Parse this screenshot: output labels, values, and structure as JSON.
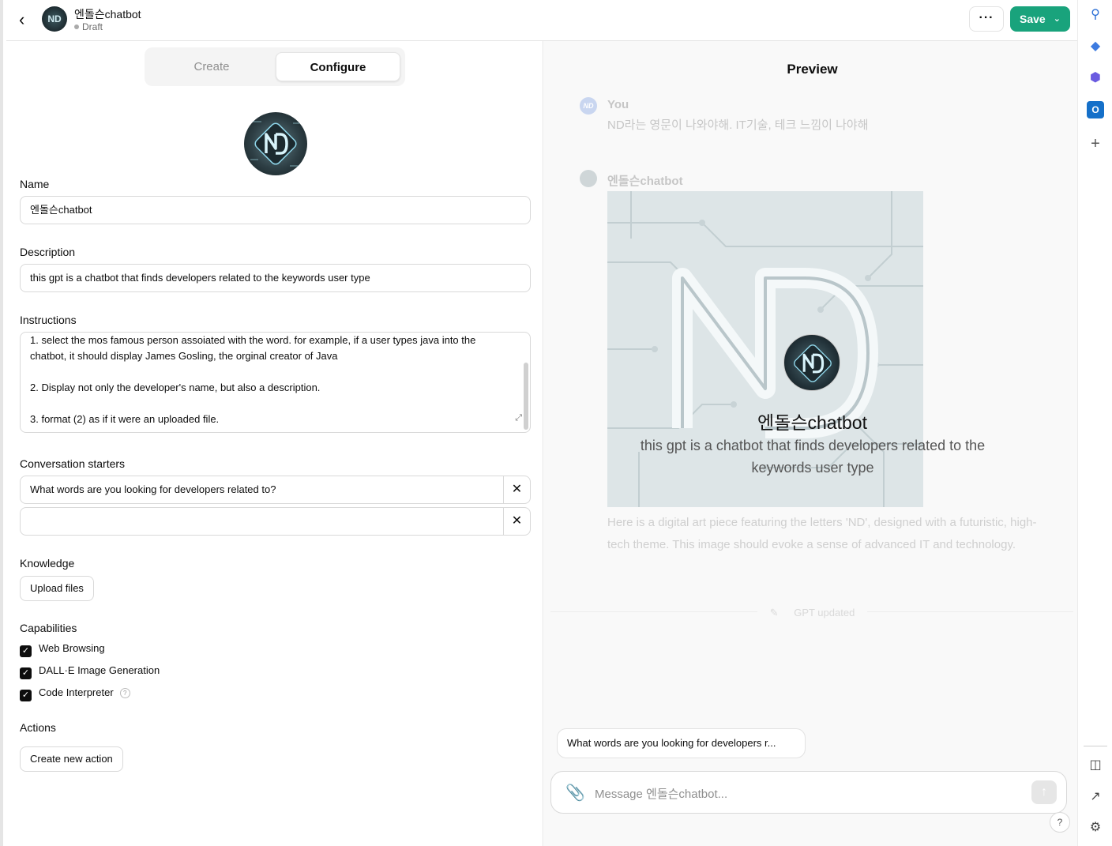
{
  "header": {
    "back_icon": "chevron-left-icon",
    "gpt_name": "엔돌슨chatbot",
    "status": "Draft",
    "more_label": "···",
    "save_label": "Save"
  },
  "tabs": {
    "create": "Create",
    "configure": "Configure",
    "active": "Configure"
  },
  "avatar_text": "ND",
  "form": {
    "name_label": "Name",
    "name_value": "엔돌슨chatbot",
    "description_label": "Description",
    "description_value": "this gpt is a chatbot that finds developers related to the keywords user type",
    "instructions_label": "Instructions",
    "instructions_lines": [
      "1. select the mos famous person assoiated with the word. for example, if a user types java into the",
      "chatbot, it should display James Gosling, the orginal creator of Java",
      "",
      "2. Display not only the developer's name, but also a description.",
      "",
      "3. format (2) as if it were an uploaded file."
    ],
    "starters_label": "Conversation starters",
    "starters": [
      "What words are you looking for developers related to?",
      ""
    ],
    "knowledge_label": "Knowledge",
    "upload_label": "Upload files",
    "capabilities_label": "Capabilities",
    "capabilities": [
      {
        "label": "Web Browsing",
        "checked": true
      },
      {
        "label": "DALL·E Image Generation",
        "checked": true
      },
      {
        "label": "Code Interpreter",
        "checked": true
      }
    ],
    "actions_label": "Actions",
    "create_action_label": "Create new action"
  },
  "preview": {
    "title": "Preview",
    "user_name": "You",
    "user_message": "ND라는 영문이 나와야해. IT기술, 테크 느낌이 나야해",
    "bot_name": "엔돌슨chatbot",
    "overlay_name": "엔돌슨chatbot",
    "overlay_description": "this gpt is a chatbot that finds developers related to the keywords user type",
    "bot_message": "Here is a digital art piece featuring the letters 'ND', designed with a futuristic, high-tech theme. This image should evoke a sense of advanced IT and technology.",
    "updated_label": "GPT updated",
    "suggestion": "What words are you looking for developers r...",
    "composer_placeholder": "Message 엔돌슨chatbot...",
    "help_label": "?"
  },
  "colors": {
    "save": "#19a37c",
    "checkbox": "#0d0d0d",
    "preview_bg": "#f9f9f9"
  }
}
